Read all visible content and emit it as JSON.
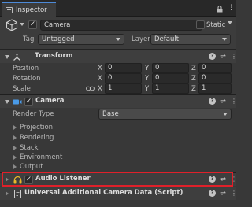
{
  "tab": {
    "title": "Inspector",
    "lock_icon": "lock-icon",
    "menu_icon": "kebab-menu-icon"
  },
  "object": {
    "name": "Camera",
    "static_label": "Static",
    "tag_label": "Tag",
    "tag_value": "Untagged",
    "layer_label": "Layer",
    "layer_value": "Default"
  },
  "transform": {
    "title": "Transform",
    "rows": [
      {
        "label": "Position",
        "x": "0",
        "y": "0",
        "z": "0"
      },
      {
        "label": "Rotation",
        "x": "0",
        "y": "0",
        "z": "0"
      },
      {
        "label": "Scale",
        "x": "1",
        "y": "1",
        "z": "1"
      }
    ],
    "axes": {
      "x": "X",
      "y": "Y",
      "z": "Z"
    }
  },
  "camera": {
    "title": "Camera",
    "render_type_label": "Render Type",
    "render_type_value": "Base",
    "sections": [
      "Projection",
      "Rendering",
      "Stack",
      "Environment",
      "Output"
    ]
  },
  "audio_listener": {
    "title": "Audio Listener"
  },
  "uacd": {
    "title": "Universal Additional Camera Data (Script)"
  },
  "colors": {
    "highlight": "#e0202a",
    "tab_accent": "#4d8ad8",
    "camera_icon": "#4a9be8",
    "audio_icon": "#e8b82a"
  }
}
